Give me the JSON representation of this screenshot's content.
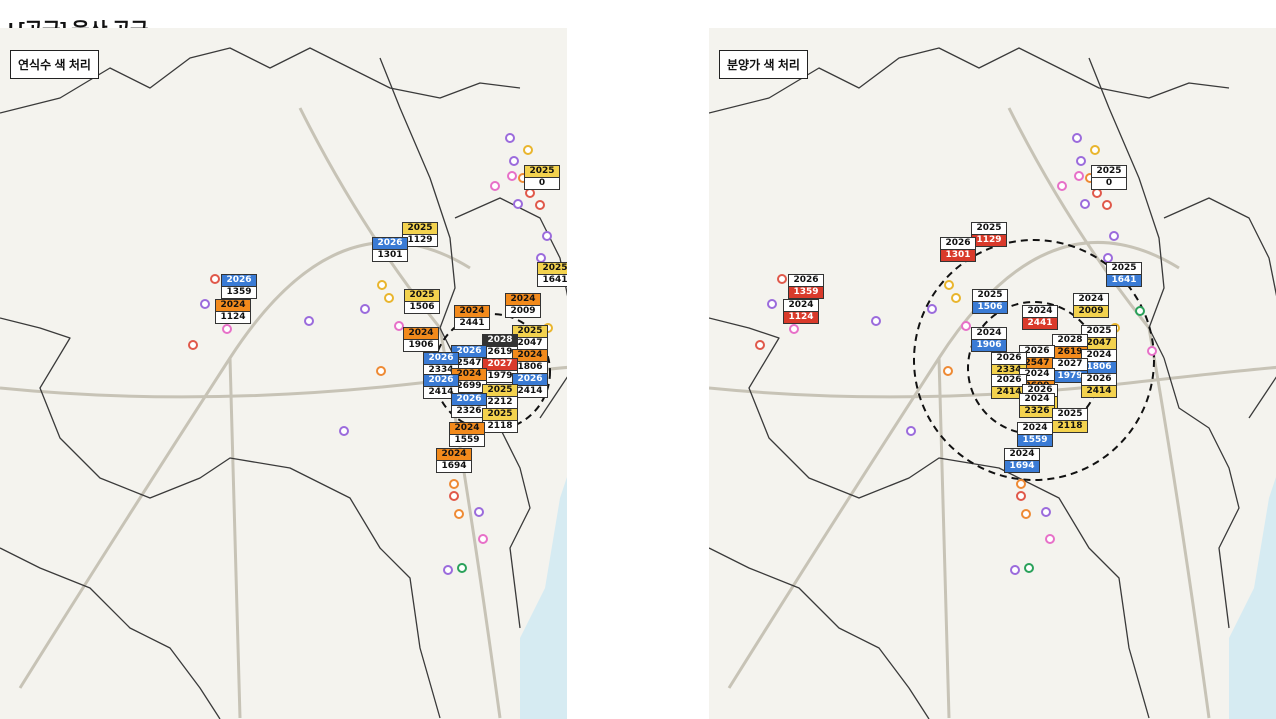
{
  "page": {
    "title": "I [공급] 울산 공급"
  },
  "colors": {
    "sea": "#d6ebf2",
    "land": "#f4f3ee",
    "boundary": "#3a3a3a",
    "road": "#c7c3b6",
    "orange": "#f28a1c",
    "yellow": "#f3d24e",
    "blue": "#3a7bd5",
    "red": "#d93a2b",
    "dark": "#333333",
    "white": "#ffffff",
    "pin_purple": "#9b6bdc",
    "pin_pink": "#e770c8",
    "pin_orange": "#ee8a34",
    "pin_red": "#e0584a",
    "pin_yellow": "#e9b52d",
    "pin_green": "#2aa15a"
  },
  "maps": [
    {
      "id": "left",
      "label": "연식수 색 처리",
      "tags": [
        {
          "year": "2025",
          "value": "0",
          "ybg": "yellow",
          "vbg": "white"
        },
        {
          "year": "2025",
          "value": "1129",
          "ybg": "yellow",
          "vbg": "white"
        },
        {
          "year": "2026",
          "value": "1301",
          "ybg": "blue",
          "vbg": "white"
        },
        {
          "year": "2026",
          "value": "1359",
          "ybg": "blue",
          "vbg": "white"
        },
        {
          "year": "2024",
          "value": "1124",
          "ybg": "orange",
          "vbg": "white"
        },
        {
          "year": "2025",
          "value": "1641",
          "ybg": "yellow",
          "vbg": "white"
        },
        {
          "year": "2025",
          "value": "1506",
          "ybg": "yellow",
          "vbg": "white"
        },
        {
          "year": "2024",
          "value": "2441",
          "ybg": "orange",
          "vbg": "white"
        },
        {
          "year": "2024",
          "value": "2009",
          "ybg": "orange",
          "vbg": "white"
        },
        {
          "year": "2024",
          "value": "1906",
          "ybg": "orange",
          "vbg": "white"
        },
        {
          "year": "2025",
          "value": "2047",
          "ybg": "yellow",
          "vbg": "white"
        },
        {
          "year": "2028",
          "value": "2619",
          "ybg": "dark",
          "vbg": "white"
        },
        {
          "year": "2026",
          "value": "2547",
          "ybg": "blue",
          "vbg": "white"
        },
        {
          "year": "2024",
          "value": "1806",
          "ybg": "orange",
          "vbg": "white"
        },
        {
          "year": "2026",
          "value": "2334",
          "ybg": "blue",
          "vbg": "white"
        },
        {
          "year": "2027",
          "value": "1979",
          "ybg": "red",
          "vbg": "white"
        },
        {
          "year": "2024",
          "value": "2699",
          "ybg": "orange",
          "vbg": "white"
        },
        {
          "year": "2026",
          "value": "2414",
          "ybg": "blue",
          "vbg": "white"
        },
        {
          "year": "2026",
          "value": "2414",
          "ybg": "blue",
          "vbg": "white"
        },
        {
          "year": "2025",
          "value": "2212",
          "ybg": "yellow",
          "vbg": "white"
        },
        {
          "year": "2026",
          "value": "2326",
          "ybg": "blue",
          "vbg": "white"
        },
        {
          "year": "2025",
          "value": "2118",
          "ybg": "yellow",
          "vbg": "white"
        },
        {
          "year": "2024",
          "value": "1559",
          "ybg": "orange",
          "vbg": "white"
        },
        {
          "year": "2024",
          "value": "1694",
          "ybg": "orange",
          "vbg": "white"
        }
      ]
    },
    {
      "id": "right",
      "label": "분양가 색 처리",
      "tags": [
        {
          "year": "2025",
          "value": "0",
          "ybg": "white",
          "vbg": "white"
        },
        {
          "year": "2025",
          "value": "1129",
          "ybg": "white",
          "vbg": "red"
        },
        {
          "year": "2026",
          "value": "1301",
          "ybg": "white",
          "vbg": "red"
        },
        {
          "year": "2026",
          "value": "1359",
          "ybg": "white",
          "vbg": "red"
        },
        {
          "year": "2024",
          "value": "1124",
          "ybg": "white",
          "vbg": "red"
        },
        {
          "year": "2025",
          "value": "1641",
          "ybg": "white",
          "vbg": "blue"
        },
        {
          "year": "2025",
          "value": "1506",
          "ybg": "white",
          "vbg": "blue"
        },
        {
          "year": "2024",
          "value": "2441",
          "ybg": "white",
          "vbg": "red"
        },
        {
          "year": "2024",
          "value": "2009",
          "ybg": "white",
          "vbg": "yellow"
        },
        {
          "year": "2024",
          "value": "1906",
          "ybg": "white",
          "vbg": "blue"
        },
        {
          "year": "2025",
          "value": "2047",
          "ybg": "white",
          "vbg": "yellow"
        },
        {
          "year": "2028",
          "value": "2619",
          "ybg": "white",
          "vbg": "orange"
        },
        {
          "year": "2026",
          "value": "2547",
          "ybg": "white",
          "vbg": "orange"
        },
        {
          "year": "2024",
          "value": "1806",
          "ybg": "white",
          "vbg": "blue"
        },
        {
          "year": "2026",
          "value": "2334",
          "ybg": "white",
          "vbg": "yellow"
        },
        {
          "year": "2027",
          "value": "1979",
          "ybg": "white",
          "vbg": "blue"
        },
        {
          "year": "2024",
          "value": "2699",
          "ybg": "white",
          "vbg": "orange"
        },
        {
          "year": "2026",
          "value": "2414",
          "ybg": "white",
          "vbg": "yellow"
        },
        {
          "year": "2026",
          "value": "2414",
          "ybg": "white",
          "vbg": "yellow"
        },
        {
          "year": "2026",
          "value": "2212",
          "ybg": "white",
          "vbg": "yellow"
        },
        {
          "year": "2024",
          "value": "2326",
          "ybg": "white",
          "vbg": "yellow"
        },
        {
          "year": "2025",
          "value": "2118",
          "ybg": "white",
          "vbg": "yellow"
        },
        {
          "year": "2024",
          "value": "1559",
          "ybg": "white",
          "vbg": "blue"
        },
        {
          "year": "2024",
          "value": "1694",
          "ybg": "white",
          "vbg": "blue"
        }
      ]
    }
  ],
  "pins": [
    {
      "color": "pin_purple"
    },
    {
      "color": "pin_yellow"
    },
    {
      "color": "pin_purple"
    },
    {
      "color": "pin_pink"
    },
    {
      "color": "pin_orange"
    },
    {
      "color": "pin_red"
    },
    {
      "color": "pin_pink"
    },
    {
      "color": "pin_purple"
    },
    {
      "color": "pin_red"
    },
    {
      "color": "pin_purple"
    },
    {
      "color": "pin_purple"
    },
    {
      "color": "pin_green"
    },
    {
      "color": "pin_yellow"
    },
    {
      "color": "pin_pink"
    },
    {
      "color": "pin_orange"
    },
    {
      "color": "pin_purple"
    },
    {
      "color": "pin_yellow"
    },
    {
      "color": "pin_pink"
    },
    {
      "color": "pin_purple"
    },
    {
      "color": "pin_yellow"
    },
    {
      "color": "pin_red"
    },
    {
      "color": "pin_pink"
    },
    {
      "color": "pin_purple"
    },
    {
      "color": "pin_red"
    },
    {
      "color": "pin_purple"
    },
    {
      "color": "pin_orange"
    },
    {
      "color": "pin_green"
    },
    {
      "color": "pin_purple"
    },
    {
      "color": "pin_red"
    },
    {
      "color": "pin_orange"
    },
    {
      "color": "pin_purple"
    },
    {
      "color": "pin_pink"
    }
  ]
}
